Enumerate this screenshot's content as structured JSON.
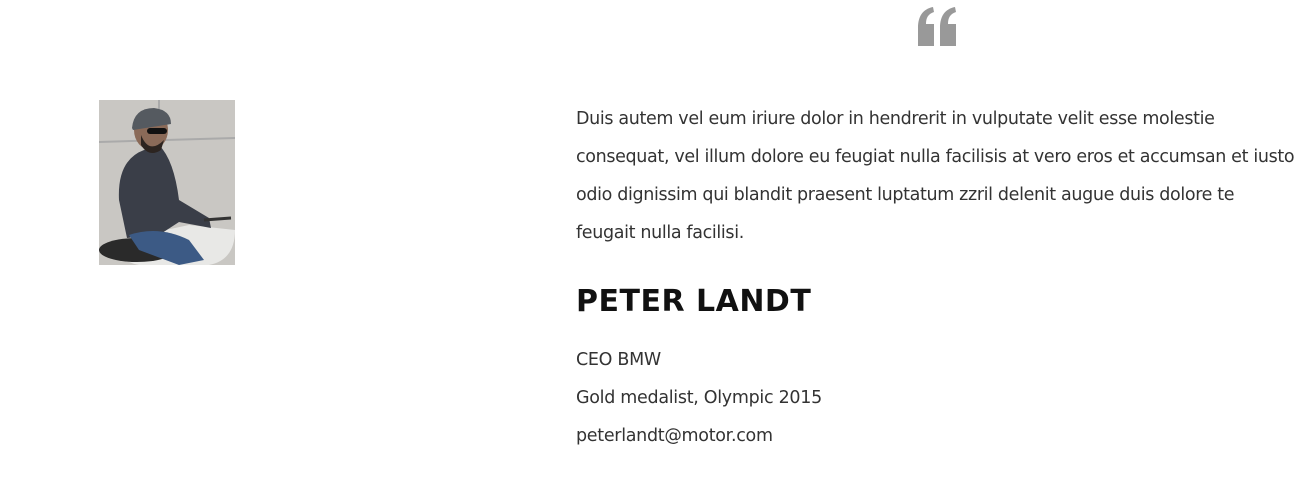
{
  "testimonial": {
    "quote_icon": "quote-left-icon",
    "quote_color": "#999999",
    "photo_alt": "Man riding a motorcycle",
    "text": "Duis autem vel eum iriure dolor in hendrerit in vulputate velit esse molestie consequat, vel illum dolore eu feugiat nulla facilisis at vero eros et accumsan et iusto odio dignissim qui blandit praesent luptatum zzril delenit augue duis dolore te feugait nulla facilisi.",
    "name": "PETER LANDT",
    "role": "CEO BMW",
    "achievement": "Gold medalist, Olympic 2015",
    "email": "peterlandt@motor.com"
  }
}
